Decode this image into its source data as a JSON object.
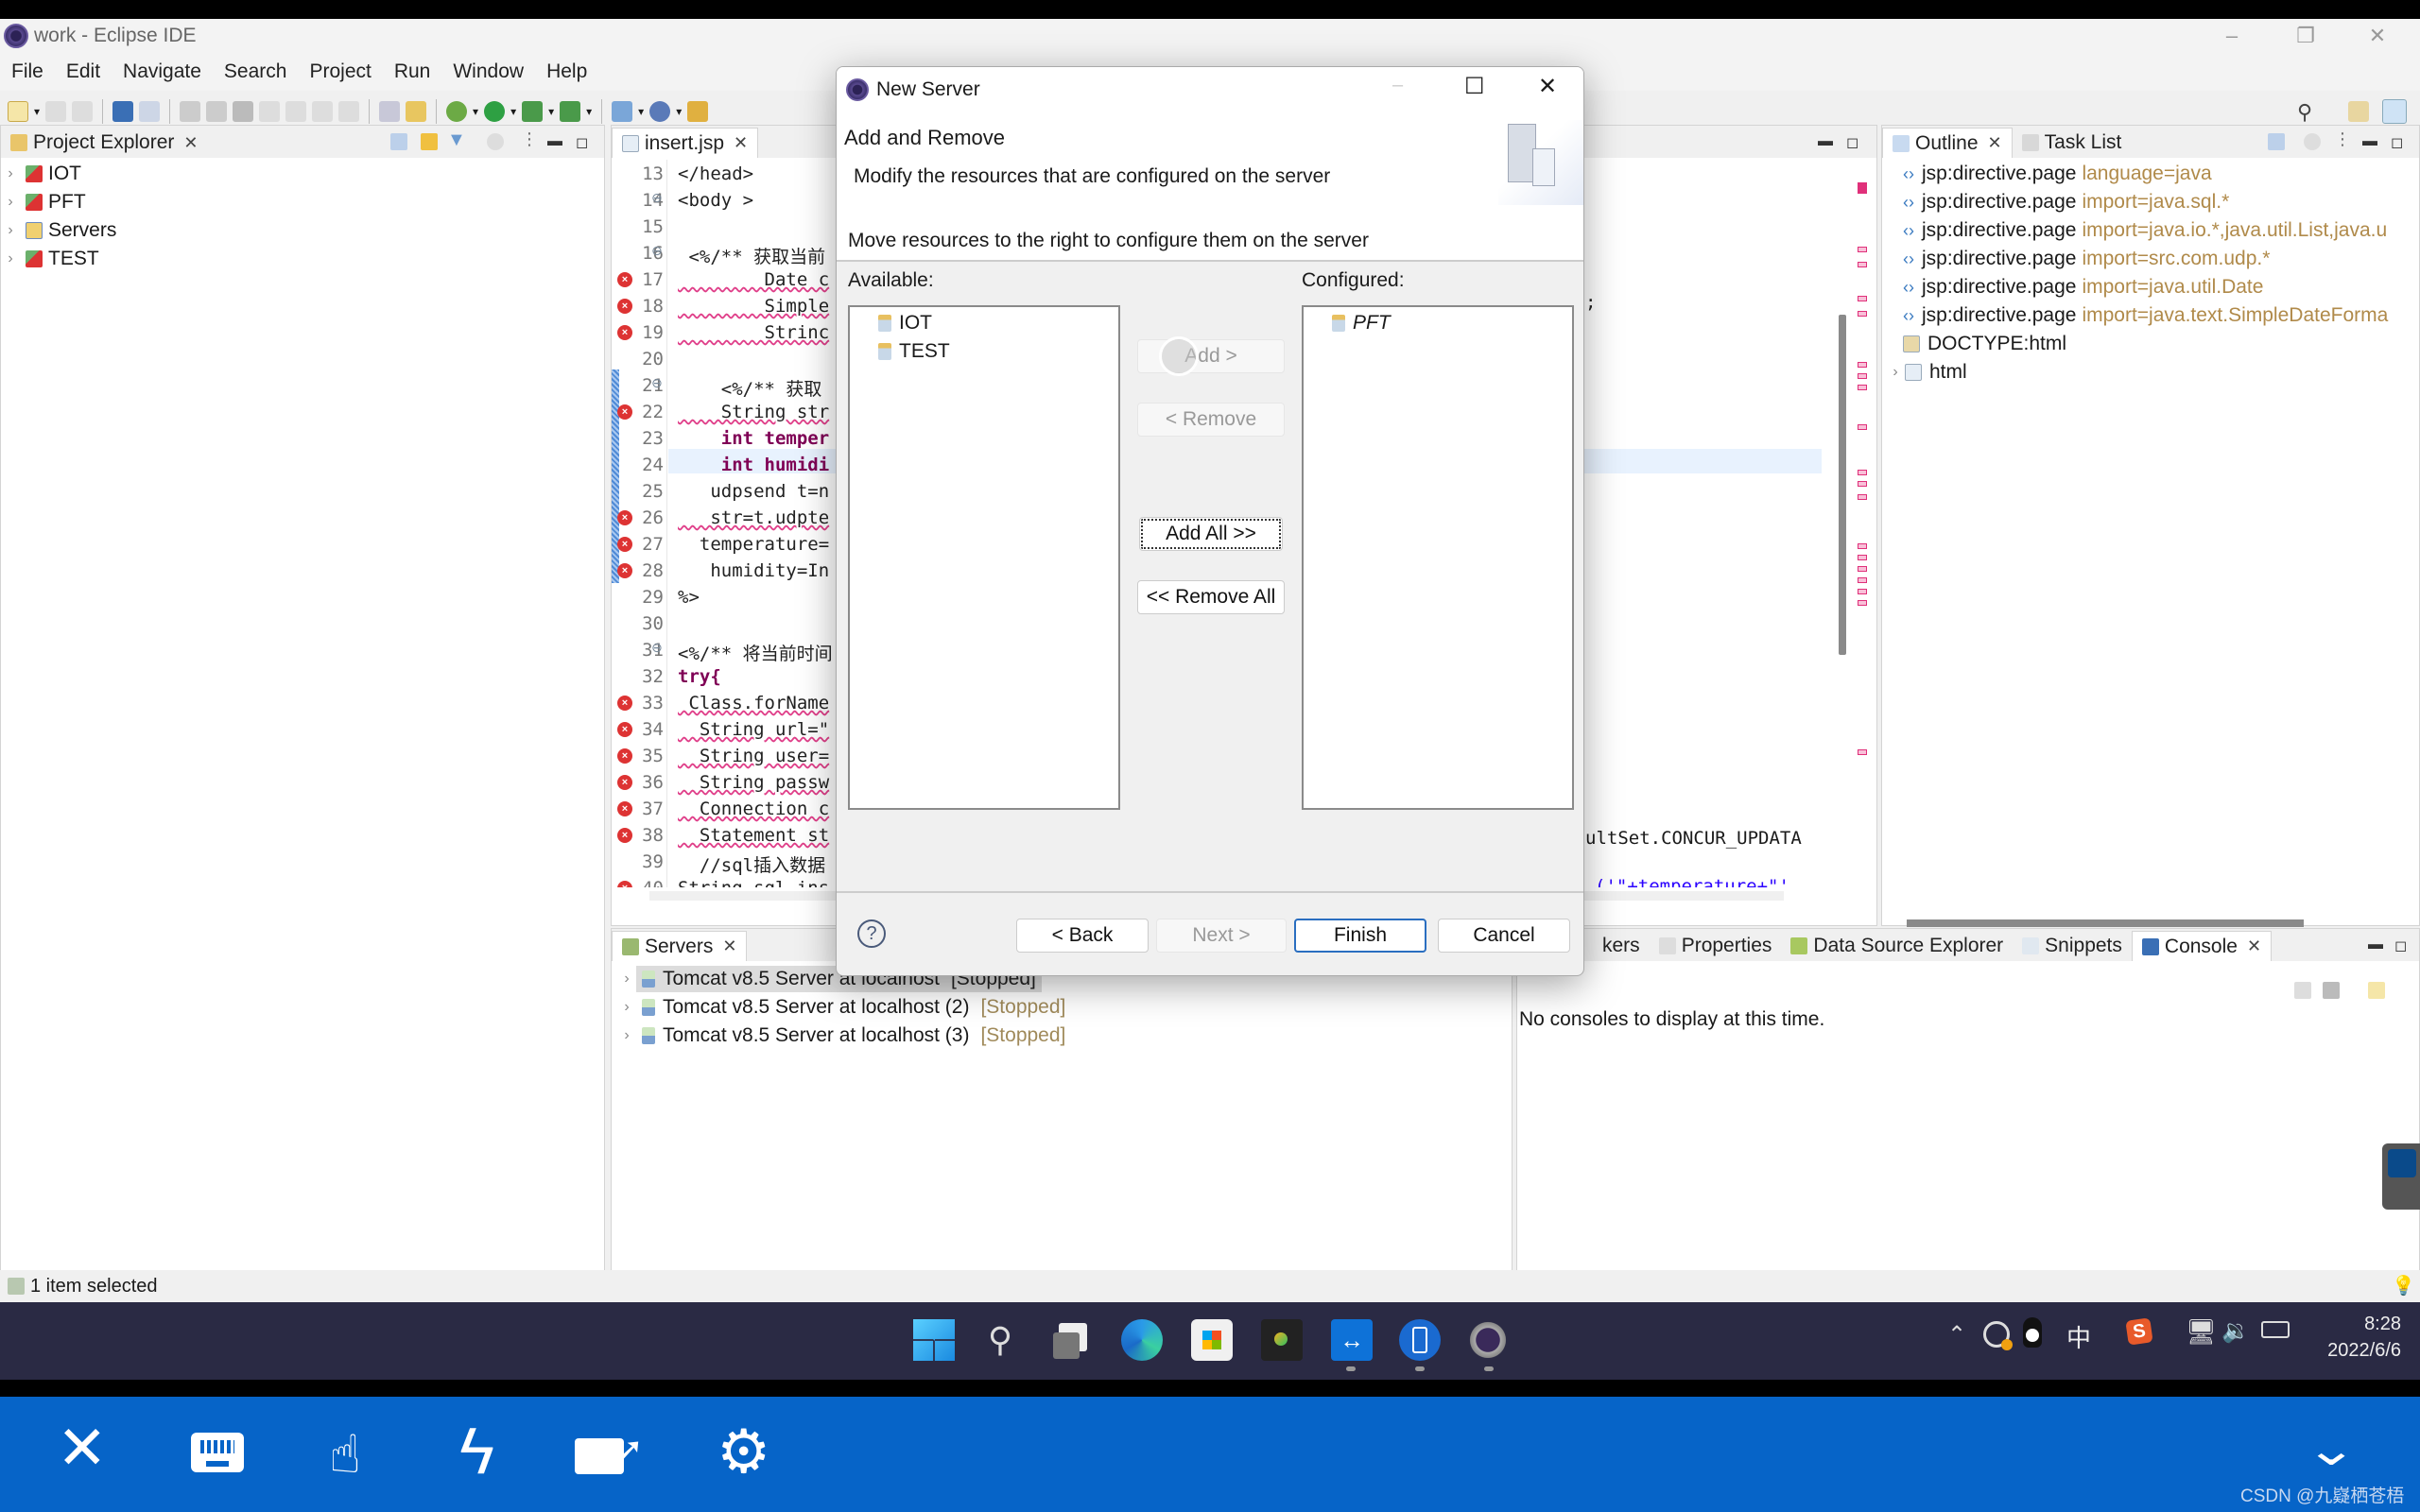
{
  "window": {
    "title": "work - Eclipse IDE",
    "controls": [
      "minimize",
      "restore",
      "close"
    ]
  },
  "menu": [
    "File",
    "Edit",
    "Navigate",
    "Search",
    "Project",
    "Run",
    "Window",
    "Help"
  ],
  "project_explorer": {
    "tab_label": "Project Explorer",
    "items": [
      {
        "label": "IOT",
        "icon": "dynamic-web-project-icon"
      },
      {
        "label": "PFT",
        "icon": "dynamic-web-project-icon"
      },
      {
        "label": "Servers",
        "icon": "folder-icon"
      },
      {
        "label": "TEST",
        "icon": "dynamic-web-project-icon"
      }
    ]
  },
  "editor": {
    "tab_label": "insert.jsp",
    "lines": [
      {
        "n": "13",
        "err": false,
        "fold": false,
        "text": "</head>",
        "kind": "tag"
      },
      {
        "n": "14",
        "err": false,
        "fold": true,
        "text": "<body >",
        "kind": "tag"
      },
      {
        "n": "15",
        "err": false,
        "fold": false,
        "text": "",
        "kind": "plain"
      },
      {
        "n": "16",
        "err": false,
        "fold": true,
        "text": " <%/** 获取当前",
        "kind": "comment"
      },
      {
        "n": "17",
        "err": true,
        "fold": false,
        "text": "        Date c",
        "kind": "err"
      },
      {
        "n": "18",
        "err": true,
        "fold": false,
        "text": "        Simple",
        "kind": "err"
      },
      {
        "n": "19",
        "err": true,
        "fold": false,
        "text": "        Strinc",
        "kind": "err"
      },
      {
        "n": "20",
        "err": false,
        "fold": false,
        "text": "",
        "kind": "plain"
      },
      {
        "n": "21",
        "err": false,
        "fold": true,
        "text": "    <%/** 获取",
        "kind": "comment"
      },
      {
        "n": "22",
        "err": true,
        "fold": false,
        "text": "    String str",
        "kind": "err"
      },
      {
        "n": "23",
        "err": false,
        "fold": false,
        "text": "    int temper",
        "kind": "int"
      },
      {
        "n": "24",
        "err": false,
        "fold": false,
        "text": "    int humidi",
        "kind": "int"
      },
      {
        "n": "25",
        "err": false,
        "fold": false,
        "text": "   udpsend t=n",
        "kind": "plain"
      },
      {
        "n": "26",
        "err": true,
        "fold": false,
        "text": "   str=t.udpte",
        "kind": "err"
      },
      {
        "n": "27",
        "err": true,
        "fold": false,
        "text": "  temperature=",
        "kind": "plain"
      },
      {
        "n": "28",
        "err": true,
        "fold": false,
        "text": "   humidity=In",
        "kind": "plain"
      },
      {
        "n": "29",
        "err": false,
        "fold": false,
        "text": "%>",
        "kind": "jsp"
      },
      {
        "n": "30",
        "err": false,
        "fold": false,
        "text": "",
        "kind": "plain"
      },
      {
        "n": "31",
        "err": false,
        "fold": true,
        "text": "<%/** 将当前时间",
        "kind": "comment"
      },
      {
        "n": "32",
        "err": false,
        "fold": false,
        "text": "try{",
        "kind": "try"
      },
      {
        "n": "33",
        "err": true,
        "fold": false,
        "text": " Class.forName",
        "kind": "err"
      },
      {
        "n": "34",
        "err": true,
        "fold": false,
        "text": "  String url=\"",
        "kind": "err"
      },
      {
        "n": "35",
        "err": true,
        "fold": false,
        "text": "  String user=",
        "kind": "err"
      },
      {
        "n": "36",
        "err": true,
        "fold": false,
        "text": "  String passw",
        "kind": "err"
      },
      {
        "n": "37",
        "err": true,
        "fold": false,
        "text": "  Connection c",
        "kind": "err"
      },
      {
        "n": "38",
        "err": true,
        "fold": false,
        "text": "  Statement st",
        "kind": "err"
      },
      {
        "n": "39",
        "err": false,
        "fold": false,
        "text": "  //sql插入数据",
        "kind": "comment"
      },
      {
        "n": "40",
        "err": true,
        "fold": false,
        "text": "String sql ins",
        "kind": "plain"
      }
    ],
    "right_fragments": {
      "line19": ";",
      "line38": "ultSet.CONCUR_UPDATA",
      "line40": "('\"+temperature+\"'"
    }
  },
  "outline": {
    "tabs": [
      "Outline",
      "Task List"
    ],
    "items": [
      {
        "name": "jsp:directive.page",
        "attr": "language=java"
      },
      {
        "name": "jsp:directive.page",
        "attr": "import=java.sql.*"
      },
      {
        "name": "jsp:directive.page",
        "attr": "import=java.io.*,java.util.List,java.u"
      },
      {
        "name": "jsp:directive.page",
        "attr": "import=src.com.udp.*"
      },
      {
        "name": "jsp:directive.page",
        "attr": "import=java.util.Date"
      },
      {
        "name": "jsp:directive.page",
        "attr": "import=java.text.SimpleDateForma"
      },
      {
        "name": "DOCTYPE:html",
        "attr": ""
      },
      {
        "name": "html",
        "attr": ""
      }
    ]
  },
  "servers_view": {
    "tab_label": "Servers",
    "items": [
      {
        "name": "Tomcat v8.5 Server at localhost",
        "state": "[Stopped]",
        "selected": true
      },
      {
        "name": "Tomcat v8.5 Server at localhost (2)",
        "state": "[Stopped]",
        "selected": false
      },
      {
        "name": "Tomcat v8.5 Server at localhost (3)",
        "state": "[Stopped]",
        "selected": false
      }
    ]
  },
  "bottom_right": {
    "tabs": [
      "kers",
      "Properties",
      "Data Source Explorer",
      "Snippets",
      "Console"
    ],
    "console_message": "No consoles to display at this time."
  },
  "status_bar": {
    "text": "1 item selected"
  },
  "dialog": {
    "title": "New Server",
    "heading": "Add and Remove",
    "description": "Modify the resources that are configured on the server",
    "instruction": "Move resources to the right to configure them on the server",
    "available_label": "Available:",
    "configured_label": "Configured:",
    "available": [
      "IOT",
      "TEST"
    ],
    "configured": [
      "PFT"
    ],
    "buttons": {
      "add": "Add >",
      "remove": "< Remove",
      "add_all": "Add All >>",
      "remove_all": "<< Remove All",
      "back": "< Back",
      "next": "Next >",
      "finish": "Finish",
      "cancel": "Cancel"
    }
  },
  "taskbar": {
    "apps": [
      "start",
      "search",
      "task-view",
      "edge",
      "store",
      "media-player",
      "teamviewer",
      "phone-link",
      "eclipse-javaee"
    ],
    "tray": {
      "ime": "中",
      "time": "8:28",
      "date": "2022/6/6"
    }
  },
  "remote_toolbar": {
    "buttons": [
      "close",
      "keyboard",
      "touch",
      "lightning",
      "keyboard-share",
      "settings"
    ],
    "watermark": "CSDN @九嶷栖苍梧"
  }
}
